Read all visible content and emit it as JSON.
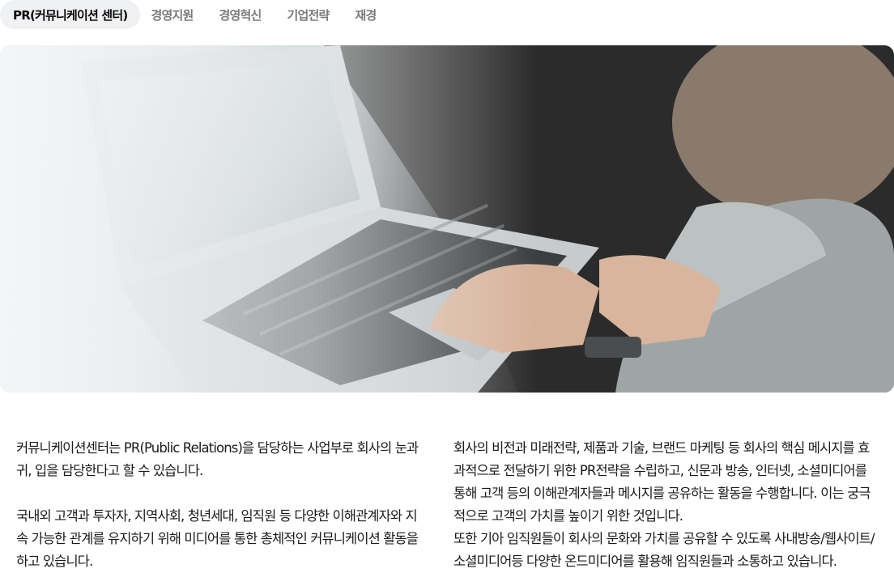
{
  "tabs": [
    {
      "label": "PR(커뮤니케이션 센터)",
      "active": true
    },
    {
      "label": "경영지원",
      "active": false
    },
    {
      "label": "경영혁신",
      "active": false
    },
    {
      "label": "기업전략",
      "active": false
    },
    {
      "label": "재경",
      "active": false
    }
  ],
  "hero": {
    "image": "person-typing-on-laptop-photo"
  },
  "content": {
    "left_p1": "커뮤니케이션센터는 PR(Public Relations)을 담당하는 사업부로 회사의 눈과 귀, 입을 담당한다고 할 수 있습니다.",
    "left_p2": "국내외 고객과 투자자, 지역사회, 청년세대, 임직원 등 다양한 이해관계자와 지속 가능한 관계를 유지하기 위해 미디어를 통한 총체적인 커뮤니케이션 활동을 하고 있습니다.",
    "right_p1": "회사의 비전과 미래전략, 제품과 기술, 브랜드 마케팅 등 회사의 핵심 메시지를 효과적으로 전달하기 위한 PR전략을 수립하고, 신문과 방송, 인터넷, 소셜미디어를 통해 고객 등의 이해관계자들과 메시지를 공유하는 활동을 수행합니다. 이는 궁극적으로 고객의 가치를 높이기 위한 것입니다.",
    "right_p2": "또한 기아 임직원들이 회사의 문화와 가치를 공유할 수 있도록 사내방송/웹사이트/소셜미디어등 다양한 온드미디어를 활용해 임직원들과 소통하고 있습니다."
  }
}
